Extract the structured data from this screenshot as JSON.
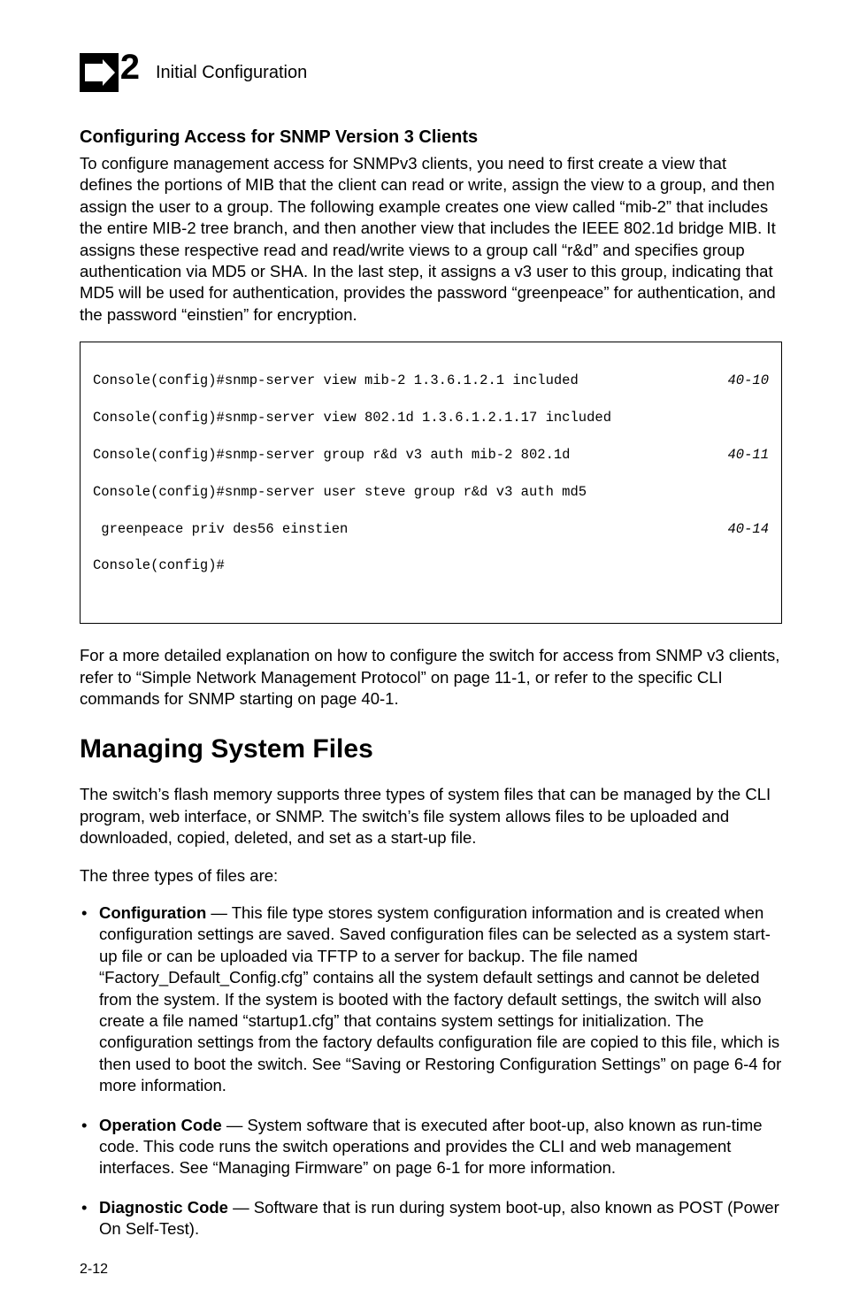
{
  "header": {
    "chapter_num": "2",
    "title": "Initial Configuration"
  },
  "sect1": {
    "heading": "Configuring Access for SNMP Version 3 Clients",
    "para": "To configure management access for SNMPv3 clients, you need to first create a view that defines the portions of MIB that the client can read or write, assign the view to a group, and then assign the user to a group. The following example creates one view called “mib-2” that includes the entire MIB-2 tree branch, and then another view that includes the IEEE 802.1d bridge MIB. It assigns these respective read and read/write views to a group call “r&d” and specifies group authentication via MD5 or SHA. In the last step, it assigns a v3 user to this group, indicating that MD5 will be used for authentication, provides the password “greenpeace” for authentication, and the password “einstien” for encryption."
  },
  "code": {
    "l1": "Console(config)#snmp-server view mib-2 1.3.6.1.2.1 included",
    "r1": "40-10",
    "l2": "Console(config)#snmp-server view 802.1d 1.3.6.1.2.1.17 included",
    "l3": "Console(config)#snmp-server group r&d v3 auth mib-2 802.1d",
    "r3": "40-11",
    "l4": "Console(config)#snmp-server user steve group r&d v3 auth md5",
    "l5": " greenpeace priv des56 einstien",
    "r5": "40-14",
    "l6": "Console(config)#"
  },
  "after_code": "For a more detailed explanation on how to configure the switch for access from SNMP v3 clients, refer to “Simple Network Management Protocol” on page 11-1, or refer to the specific CLI commands for SNMP starting on page 40-1.",
  "h1": "Managing System Files",
  "msf_para1": "The switch’s flash memory supports three types of system files that can be managed by the CLI program, web interface, or SNMP. The switch’s file system allows files to be uploaded and downloaded, copied, deleted, and set as a start-up file.",
  "msf_para2": "The three types of files are:",
  "bullets": {
    "b1_label": "Configuration",
    "b1_text": " — This file type stores system configuration information and is created when configuration settings are saved. Saved configuration files can be selected as a system start-up file or can be uploaded via TFTP to a server for backup. The file named “Factory_Default_Config.cfg” contains all the system default settings and cannot be deleted from the system. If the system is booted with the factory default settings, the switch will also create a file named “startup1.cfg” that contains system settings for initialization. The configuration settings from the factory defaults configuration file are copied to this file, which is then used to boot the switch. See “Saving or Restoring Configuration Settings” on page 6-4 for more information.",
    "b2_label": "Operation Code",
    "b2_text": " — System software that is executed after boot-up, also known as run-time code. This code runs the switch operations and provides the CLI and web management interfaces. See “Managing Firmware” on page 6-1 for more information.",
    "b3_label": "Diagnostic Code",
    "b3_text": " — Software that is run during system boot-up, also known as POST (Power On Self-Test)."
  },
  "footer": "2-12"
}
